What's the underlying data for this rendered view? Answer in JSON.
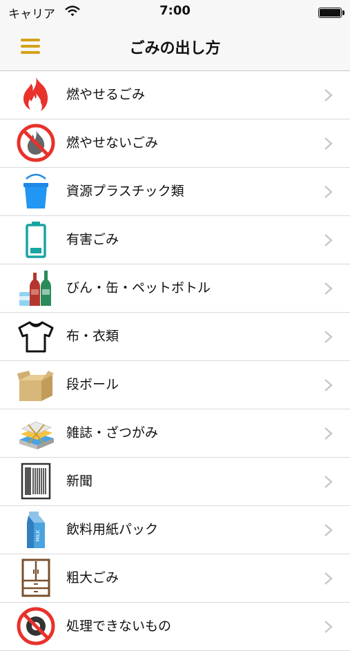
{
  "status_bar": {
    "carrier": "キャリア",
    "time": "7:00"
  },
  "nav": {
    "title": "ごみの出し方"
  },
  "items": [
    {
      "label": "燃やせるごみ",
      "icon": "fire-icon"
    },
    {
      "label": "燃やせないごみ",
      "icon": "no-burn-icon"
    },
    {
      "label": "資源プラスチック類",
      "icon": "bucket-icon"
    },
    {
      "label": "有害ごみ",
      "icon": "battery-icon"
    },
    {
      "label": "びん・缶・ペットボトル",
      "icon": "bottles-icon"
    },
    {
      "label": "布・衣類",
      "icon": "tshirt-icon"
    },
    {
      "label": "段ボール",
      "icon": "cardboard-box-icon"
    },
    {
      "label": "雑誌・ざつがみ",
      "icon": "magazines-icon"
    },
    {
      "label": "新聞",
      "icon": "newspaper-icon"
    },
    {
      "label": "飲料用紙パック",
      "icon": "milk-carton-icon"
    },
    {
      "label": "粗大ごみ",
      "icon": "cabinet-icon"
    },
    {
      "label": "処理できないもの",
      "icon": "prohibited-tire-icon"
    }
  ],
  "colors": {
    "accent": "#d4a017",
    "fire": "#e8322b",
    "blue": "#1e88e5",
    "teal": "#1aa3a3"
  }
}
